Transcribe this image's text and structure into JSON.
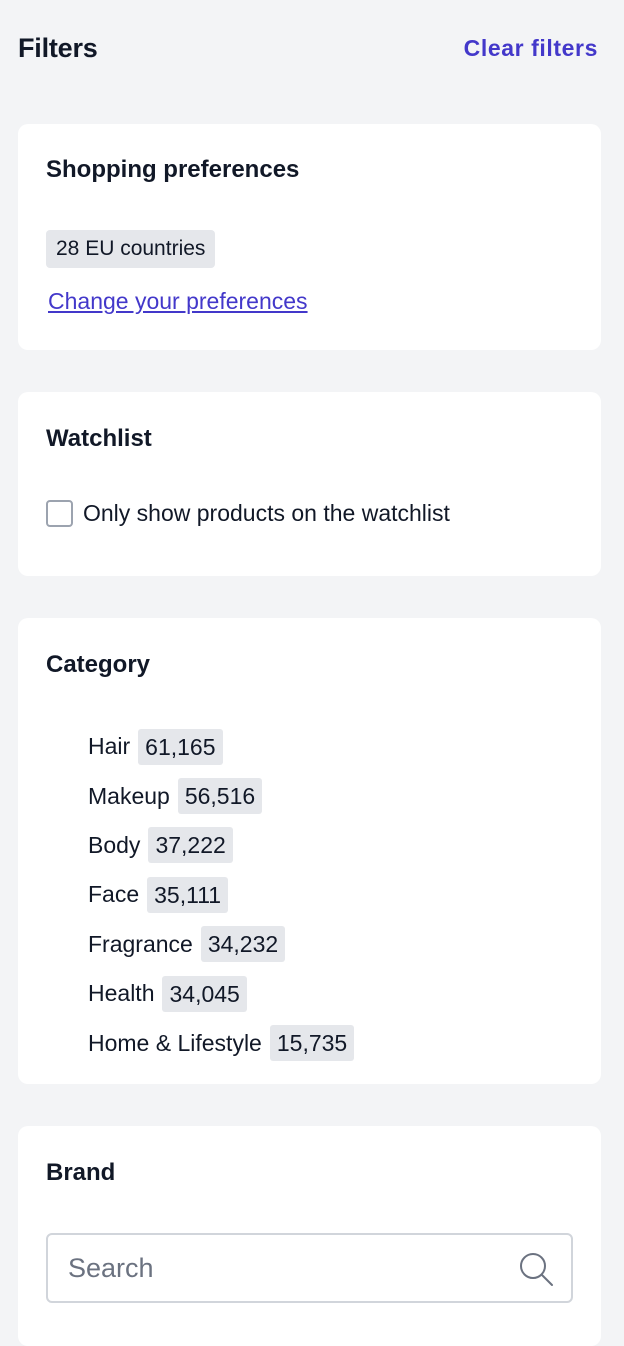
{
  "header": {
    "title": "Filters",
    "clear_label": "Clear filters"
  },
  "shopping_preferences": {
    "title": "Shopping preferences",
    "badge": "28 EU countries",
    "link": "Change your preferences"
  },
  "watchlist": {
    "title": "Watchlist",
    "checkbox_label": "Only show products on the watchlist",
    "checked": false
  },
  "category": {
    "title": "Category",
    "items": [
      {
        "label": "Hair",
        "count": "61,165"
      },
      {
        "label": "Makeup",
        "count": "56,516"
      },
      {
        "label": "Body",
        "count": "37,222"
      },
      {
        "label": "Face",
        "count": "35,111"
      },
      {
        "label": "Fragrance",
        "count": "34,232"
      },
      {
        "label": "Health",
        "count": "34,045"
      },
      {
        "label": "Home & Lifestyle",
        "count": "15,735"
      }
    ]
  },
  "brand": {
    "title": "Brand",
    "search_placeholder": "Search",
    "search_value": ""
  },
  "colors": {
    "accent": "#4338ca",
    "background": "#f3f4f6",
    "card": "#ffffff",
    "badge": "#e5e7eb"
  },
  "icons": {
    "search": "search-icon"
  }
}
